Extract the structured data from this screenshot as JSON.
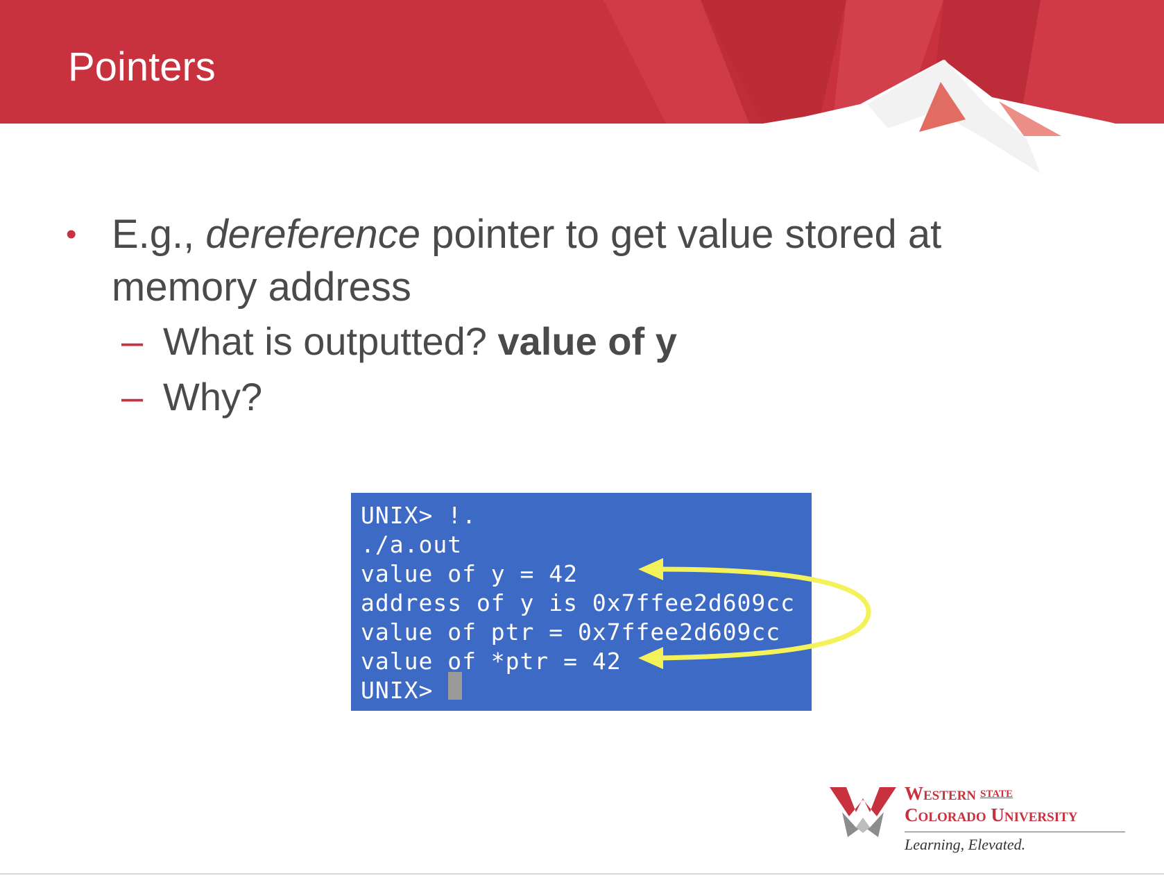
{
  "slide": {
    "title": "Pointers"
  },
  "bullets": {
    "main": {
      "prefix": "E.g., ",
      "emphasis": "dereference",
      "suffix": " pointer to get value stored at memory address"
    },
    "sub": [
      {
        "text": "What is outputted? ",
        "bold": "value of y"
      },
      {
        "text": "Why?",
        "bold": ""
      }
    ],
    "bullet_glyph": "•",
    "dash_glyph": "–"
  },
  "terminal": {
    "lines": [
      "UNIX> !.",
      "./a.out",
      "value of y = 42",
      "address of y is 0x7ffee2d609cc",
      "value of ptr = 0x7ffee2d609cc",
      "value of *ptr = 42",
      "UNIX>"
    ],
    "background": "#3c6ac4",
    "arrow_color": "#f4f25a"
  },
  "logo": {
    "name_line1": "Western",
    "state": "STATE",
    "name_line2": "Colorado University",
    "tagline": "Learning, Elevated."
  },
  "colors": {
    "header_red": "#c8323e",
    "accent_red": "#c8323e",
    "body_text": "#4a4a4a"
  }
}
